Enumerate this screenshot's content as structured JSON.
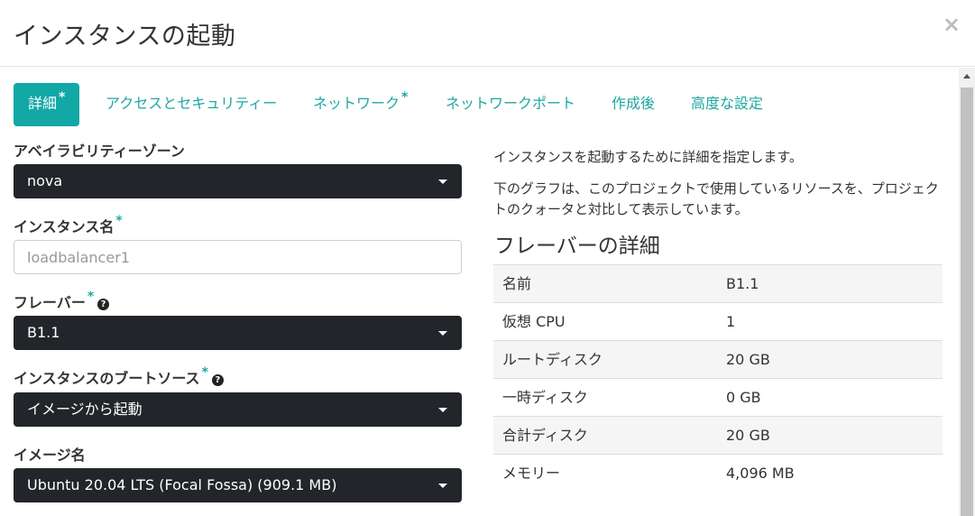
{
  "dialog": {
    "title": "インスタンスの起動",
    "close": "×"
  },
  "tabs": [
    {
      "label": "詳細",
      "required": "*",
      "active": true
    },
    {
      "label": "アクセスとセキュリティー",
      "required": ""
    },
    {
      "label": "ネットワーク",
      "required": "*"
    },
    {
      "label": "ネットワークポート",
      "required": ""
    },
    {
      "label": "作成後",
      "required": ""
    },
    {
      "label": "高度な設定",
      "required": ""
    }
  ],
  "form": {
    "availability_zone": {
      "label": "アベイラビリティーゾーン",
      "value": "nova"
    },
    "instance_name": {
      "label": "インスタンス名",
      "required": "*",
      "placeholder": "loadbalancer1"
    },
    "flavor": {
      "label": "フレーバー",
      "required": "*",
      "help": "?",
      "value": "B1.1"
    },
    "boot_source": {
      "label": "インスタンスのブートソース",
      "required": "*",
      "help": "?",
      "value": "イメージから起動"
    },
    "image_name": {
      "label": "イメージ名",
      "value": "Ubuntu 20.04 LTS (Focal Fossa) (909.1 MB)"
    }
  },
  "info": {
    "line1": "インスタンスを起動するために詳細を指定します。",
    "line2": "下のグラフは、このプロジェクトで使用しているリソースを、プロジェクトのクォータと対比して表示しています。"
  },
  "flavor_details": {
    "title": "フレーバーの詳細",
    "rows": [
      {
        "name": "名前",
        "value": "B1.1"
      },
      {
        "name": "仮想 CPU",
        "value": "1"
      },
      {
        "name": "ルートディスク",
        "value": "20 GB"
      },
      {
        "name": "一時ディスク",
        "value": "0 GB"
      },
      {
        "name": "合計ディスク",
        "value": "20 GB"
      },
      {
        "name": "メモリー",
        "value": "4,096 MB"
      }
    ]
  },
  "colors": {
    "accent": "#12a8a6",
    "link": "#1fa7a0",
    "select_bg": "#222529"
  }
}
